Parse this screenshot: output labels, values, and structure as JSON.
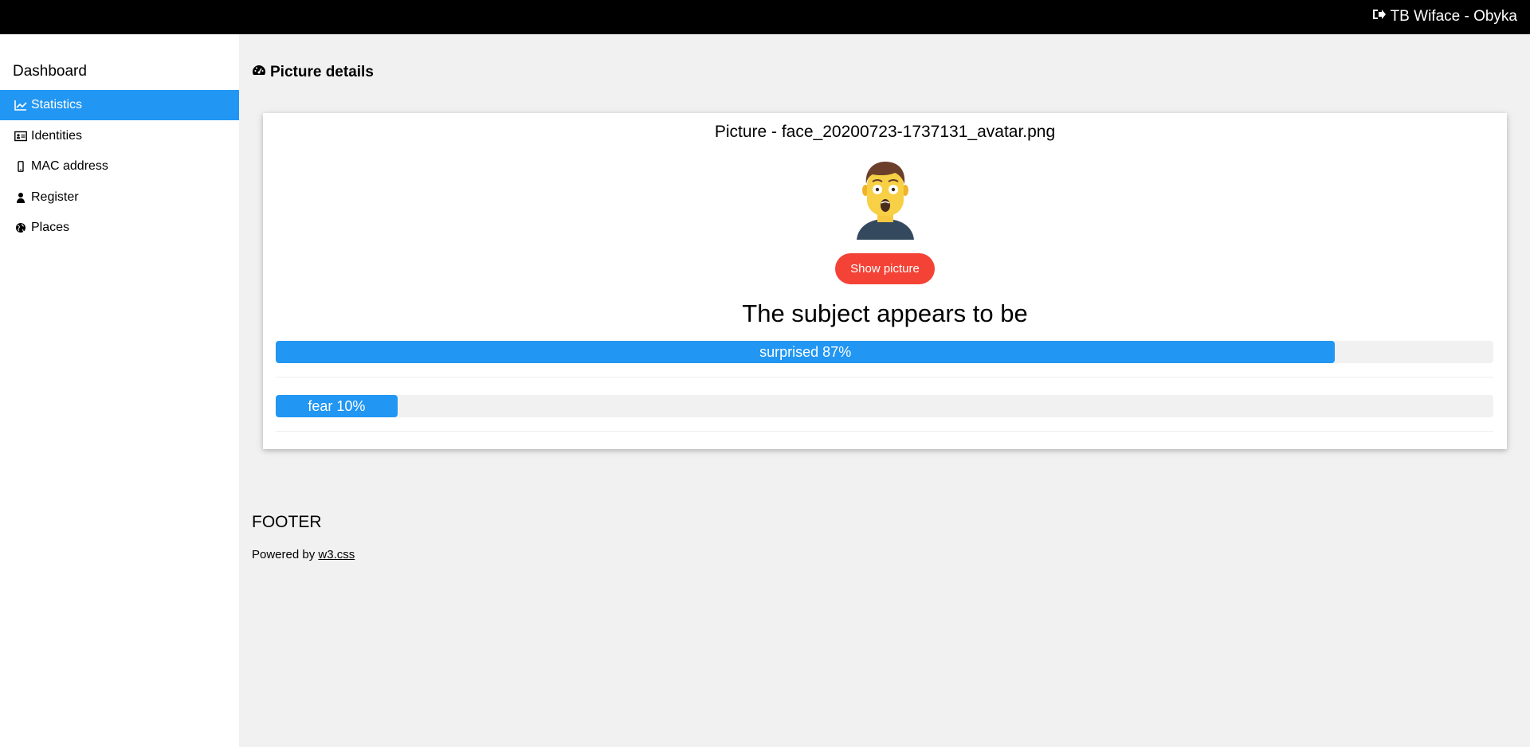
{
  "topbar": {
    "title": "TB Wiface - Obyka",
    "icon": "sign-out-icon"
  },
  "sidebar": {
    "heading": "Dashboard",
    "items": [
      {
        "label": "Statistics",
        "icon": "line-chart-icon",
        "active": true
      },
      {
        "label": "Identities",
        "icon": "id-card-icon",
        "active": false
      },
      {
        "label": "MAC address",
        "icon": "mobile-icon",
        "active": false
      },
      {
        "label": "Register",
        "icon": "user-icon",
        "active": false
      },
      {
        "label": "Places",
        "icon": "globe-icon",
        "active": false
      }
    ]
  },
  "main": {
    "title": "Picture details",
    "card": {
      "title": "Picture - face_20200723-1737131_avatar.png",
      "button": "Show picture",
      "subject_heading": "The subject appears to be",
      "emotions": [
        {
          "label": "surprised 87%",
          "value": 0.87
        },
        {
          "label": "fear 10%",
          "value": 0.1
        }
      ]
    }
  },
  "footer": {
    "title": "FOOTER",
    "text": "Powered by",
    "link": "w3.css"
  },
  "colors": {
    "accent": "#2196F3",
    "danger": "#f44336",
    "background": "#f1f1f1"
  }
}
